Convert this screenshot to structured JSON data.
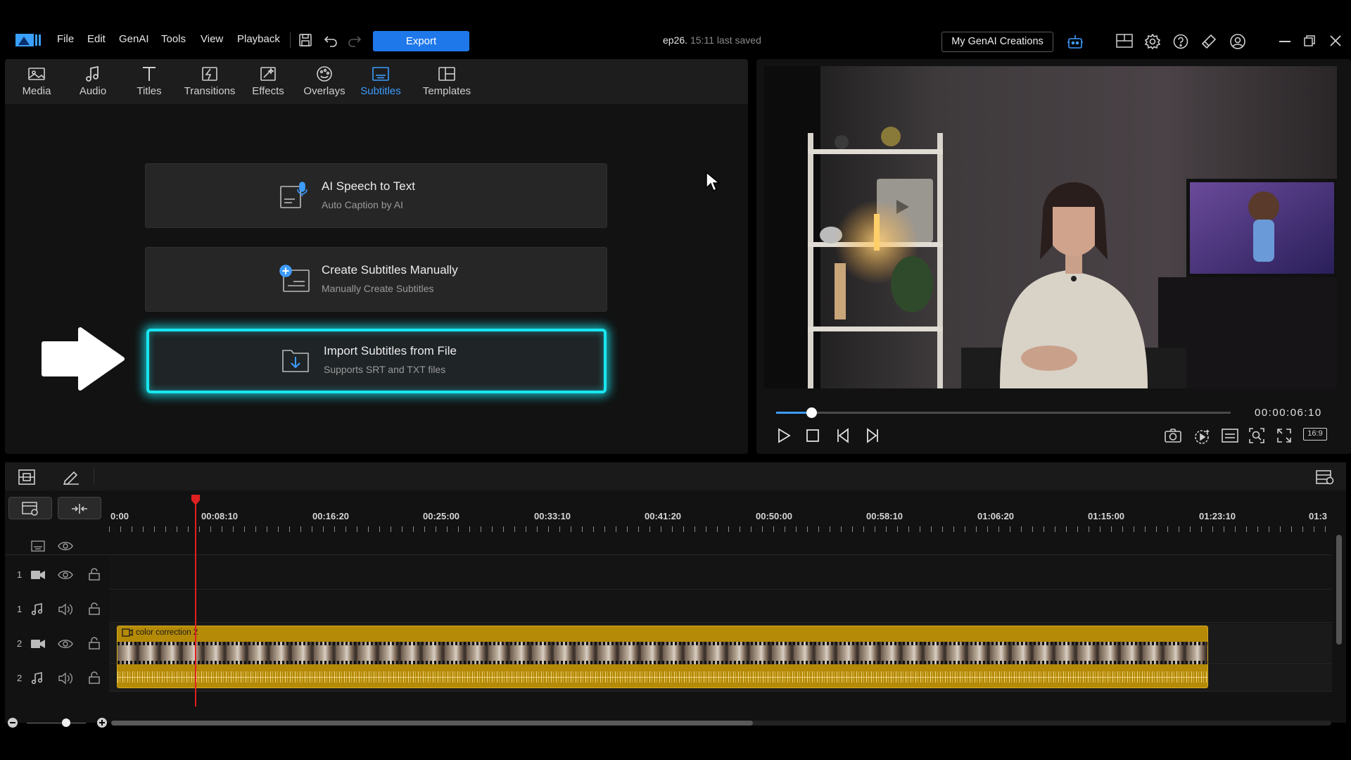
{
  "app": {
    "menu": [
      "File",
      "Edit",
      "GenAI",
      "Tools",
      "View",
      "Playback"
    ],
    "export_label": "Export",
    "project_name": "ep26.",
    "saved_status": "15:11 last saved",
    "genai_button": "My GenAI Creations"
  },
  "library": {
    "tabs": [
      {
        "label": "Media",
        "icon": "media-icon"
      },
      {
        "label": "Audio",
        "icon": "music-note-icon"
      },
      {
        "label": "Titles",
        "icon": "title-t-icon"
      },
      {
        "label": "Transitions",
        "icon": "transition-icon"
      },
      {
        "label": "Effects",
        "icon": "effects-icon"
      },
      {
        "label": "Overlays",
        "icon": "overlays-icon"
      },
      {
        "label": "Subtitles",
        "icon": "subtitles-icon"
      },
      {
        "label": "Templates",
        "icon": "templates-icon"
      }
    ],
    "active_tab": "Subtitles",
    "options": [
      {
        "title": "AI Speech to Text",
        "subtitle": "Auto Caption by AI",
        "icon": "speech-to-text-icon"
      },
      {
        "title": "Create Subtitles Manually",
        "subtitle": "Manually Create Subtitles",
        "icon": "add-subtitle-icon"
      },
      {
        "title": "Import Subtitles from File",
        "subtitle": "Supports SRT and TXT files",
        "icon": "import-file-icon"
      }
    ]
  },
  "preview": {
    "timecode": "00:00:06:10",
    "progress": 0.077,
    "aspect_label": "16:9"
  },
  "timeline": {
    "ruler": [
      "0:00",
      "00:08:10",
      "00:16:20",
      "00:25:00",
      "00:33:10",
      "00:41:20",
      "00:50:00",
      "00:58:10",
      "01:06:20",
      "01:15:00",
      "01:23:10",
      "01:3"
    ],
    "tracks": [
      {
        "num": "",
        "type": "subtitle"
      },
      {
        "num": "1",
        "type": "video"
      },
      {
        "num": "1",
        "type": "audio"
      },
      {
        "num": "2",
        "type": "video"
      },
      {
        "num": "2",
        "type": "audio"
      }
    ],
    "clip_name": "color correction 2"
  },
  "colors": {
    "accent": "#1f78ea",
    "active_tab": "#3d9cff",
    "highlight_glow": "#18e6f0",
    "clip": "#b58a07",
    "playhead": "#e02020"
  }
}
